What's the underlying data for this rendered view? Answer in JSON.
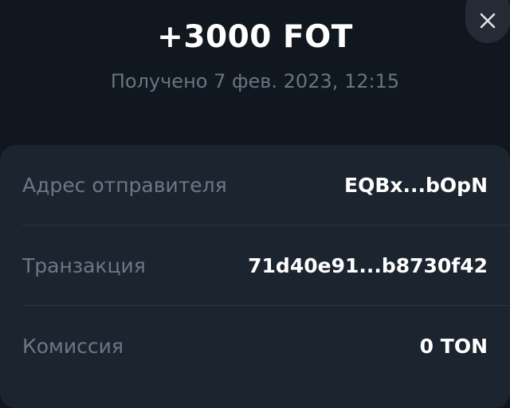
{
  "header": {
    "amount": "+3000 FOT",
    "received": "Получено 7 фев. 2023, 12:15"
  },
  "details": {
    "rows": [
      {
        "label": "Адрес отправителя",
        "value": "EQBx...bOpN"
      },
      {
        "label": "Транзакция",
        "value": "71d40e91...b8730f42"
      },
      {
        "label": "Комиссия",
        "value": "0 TON"
      }
    ]
  },
  "icons": {
    "close": "close-icon"
  },
  "colors": {
    "background": "#11171e",
    "card": "#1c242f",
    "muted_text": "#6d7785",
    "primary_text": "#ffffff"
  }
}
